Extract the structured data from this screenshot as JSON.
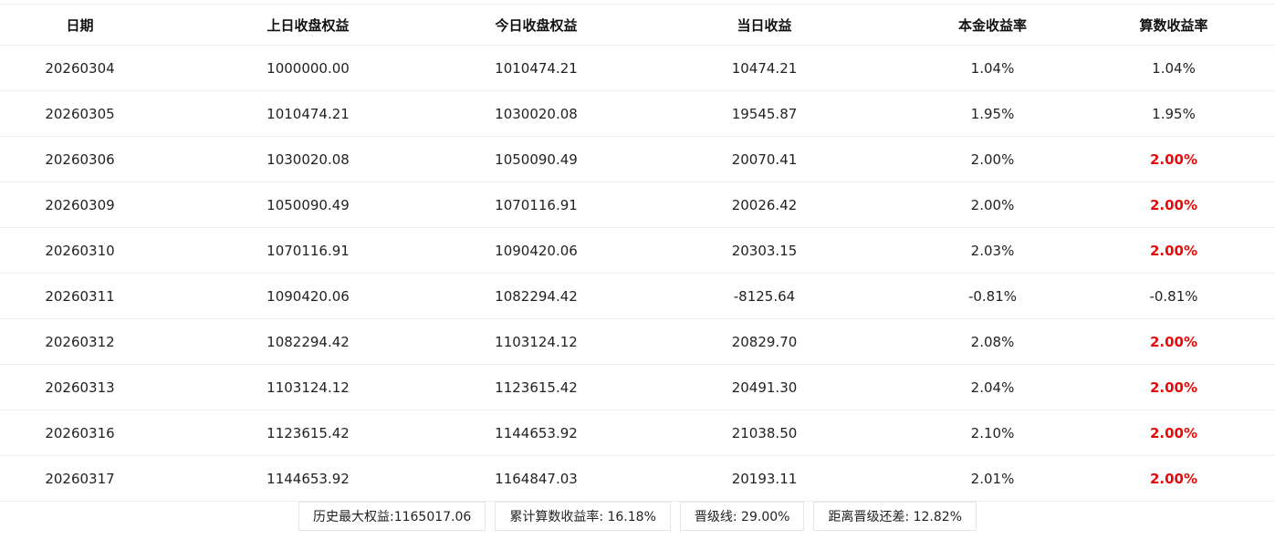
{
  "table": {
    "columns": [
      "日期",
      "上日收盘权益",
      "今日收盘权益",
      "当日收益",
      "本金收益率",
      "算数收益率"
    ],
    "rows": [
      {
        "date": "20260304",
        "prev_equity": "1000000.00",
        "today_equity": "1010474.21",
        "daily_profit": "10474.21",
        "principal_rate": "1.04%",
        "calc_rate": "1.04%",
        "calc_rate_capped": false
      },
      {
        "date": "20260305",
        "prev_equity": "1010474.21",
        "today_equity": "1030020.08",
        "daily_profit": "19545.87",
        "principal_rate": "1.95%",
        "calc_rate": "1.95%",
        "calc_rate_capped": false
      },
      {
        "date": "20260306",
        "prev_equity": "1030020.08",
        "today_equity": "1050090.49",
        "daily_profit": "20070.41",
        "principal_rate": "2.00%",
        "calc_rate": "2.00%",
        "calc_rate_capped": true
      },
      {
        "date": "20260309",
        "prev_equity": "1050090.49",
        "today_equity": "1070116.91",
        "daily_profit": "20026.42",
        "principal_rate": "2.00%",
        "calc_rate": "2.00%",
        "calc_rate_capped": true
      },
      {
        "date": "20260310",
        "prev_equity": "1070116.91",
        "today_equity": "1090420.06",
        "daily_profit": "20303.15",
        "principal_rate": "2.03%",
        "calc_rate": "2.00%",
        "calc_rate_capped": true
      },
      {
        "date": "20260311",
        "prev_equity": "1090420.06",
        "today_equity": "1082294.42",
        "daily_profit": "-8125.64",
        "principal_rate": "-0.81%",
        "calc_rate": "-0.81%",
        "calc_rate_capped": false
      },
      {
        "date": "20260312",
        "prev_equity": "1082294.42",
        "today_equity": "1103124.12",
        "daily_profit": "20829.70",
        "principal_rate": "2.08%",
        "calc_rate": "2.00%",
        "calc_rate_capped": true
      },
      {
        "date": "20260313",
        "prev_equity": "1103124.12",
        "today_equity": "1123615.42",
        "daily_profit": "20491.30",
        "principal_rate": "2.04%",
        "calc_rate": "2.00%",
        "calc_rate_capped": true
      },
      {
        "date": "20260316",
        "prev_equity": "1123615.42",
        "today_equity": "1144653.92",
        "daily_profit": "21038.50",
        "principal_rate": "2.10%",
        "calc_rate": "2.00%",
        "calc_rate_capped": true
      },
      {
        "date": "20260317",
        "prev_equity": "1144653.92",
        "today_equity": "1164847.03",
        "daily_profit": "20193.11",
        "principal_rate": "2.01%",
        "calc_rate": "2.00%",
        "calc_rate_capped": true
      }
    ]
  },
  "summary": {
    "max_equity": "历史最大权益:1165017.06",
    "cumulative_rate": "累计算数收益率: 16.18%",
    "promotion_line": "晋级线: 29.00%",
    "gap_to_promotion": "距离晋级还差: 12.82%"
  },
  "colors": {
    "capped_rate": "#e30b0b"
  }
}
